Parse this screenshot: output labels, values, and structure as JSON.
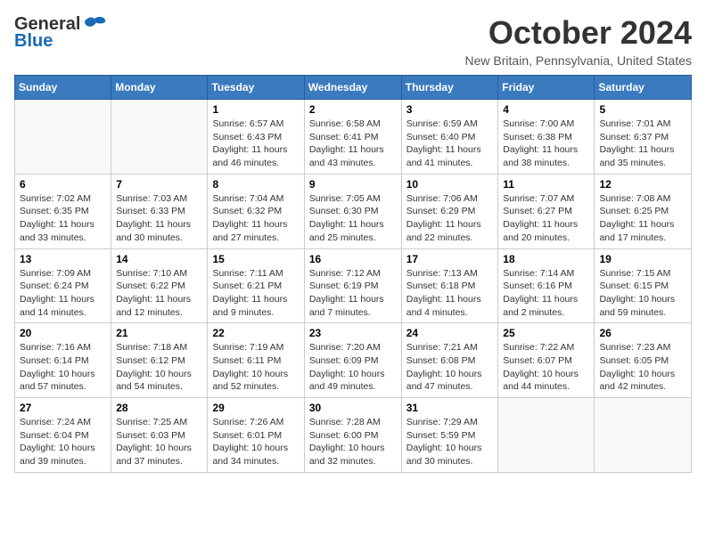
{
  "header": {
    "logo_general": "General",
    "logo_blue": "Blue",
    "month_title": "October 2024",
    "location": "New Britain, Pennsylvania, United States"
  },
  "weekdays": [
    "Sunday",
    "Monday",
    "Tuesday",
    "Wednesday",
    "Thursday",
    "Friday",
    "Saturday"
  ],
  "weeks": [
    [
      {
        "day": "",
        "info": ""
      },
      {
        "day": "",
        "info": ""
      },
      {
        "day": "1",
        "info": "Sunrise: 6:57 AM\nSunset: 6:43 PM\nDaylight: 11 hours and 46 minutes."
      },
      {
        "day": "2",
        "info": "Sunrise: 6:58 AM\nSunset: 6:41 PM\nDaylight: 11 hours and 43 minutes."
      },
      {
        "day": "3",
        "info": "Sunrise: 6:59 AM\nSunset: 6:40 PM\nDaylight: 11 hours and 41 minutes."
      },
      {
        "day": "4",
        "info": "Sunrise: 7:00 AM\nSunset: 6:38 PM\nDaylight: 11 hours and 38 minutes."
      },
      {
        "day": "5",
        "info": "Sunrise: 7:01 AM\nSunset: 6:37 PM\nDaylight: 11 hours and 35 minutes."
      }
    ],
    [
      {
        "day": "6",
        "info": "Sunrise: 7:02 AM\nSunset: 6:35 PM\nDaylight: 11 hours and 33 minutes."
      },
      {
        "day": "7",
        "info": "Sunrise: 7:03 AM\nSunset: 6:33 PM\nDaylight: 11 hours and 30 minutes."
      },
      {
        "day": "8",
        "info": "Sunrise: 7:04 AM\nSunset: 6:32 PM\nDaylight: 11 hours and 27 minutes."
      },
      {
        "day": "9",
        "info": "Sunrise: 7:05 AM\nSunset: 6:30 PM\nDaylight: 11 hours and 25 minutes."
      },
      {
        "day": "10",
        "info": "Sunrise: 7:06 AM\nSunset: 6:29 PM\nDaylight: 11 hours and 22 minutes."
      },
      {
        "day": "11",
        "info": "Sunrise: 7:07 AM\nSunset: 6:27 PM\nDaylight: 11 hours and 20 minutes."
      },
      {
        "day": "12",
        "info": "Sunrise: 7:08 AM\nSunset: 6:25 PM\nDaylight: 11 hours and 17 minutes."
      }
    ],
    [
      {
        "day": "13",
        "info": "Sunrise: 7:09 AM\nSunset: 6:24 PM\nDaylight: 11 hours and 14 minutes."
      },
      {
        "day": "14",
        "info": "Sunrise: 7:10 AM\nSunset: 6:22 PM\nDaylight: 11 hours and 12 minutes."
      },
      {
        "day": "15",
        "info": "Sunrise: 7:11 AM\nSunset: 6:21 PM\nDaylight: 11 hours and 9 minutes."
      },
      {
        "day": "16",
        "info": "Sunrise: 7:12 AM\nSunset: 6:19 PM\nDaylight: 11 hours and 7 minutes."
      },
      {
        "day": "17",
        "info": "Sunrise: 7:13 AM\nSunset: 6:18 PM\nDaylight: 11 hours and 4 minutes."
      },
      {
        "day": "18",
        "info": "Sunrise: 7:14 AM\nSunset: 6:16 PM\nDaylight: 11 hours and 2 minutes."
      },
      {
        "day": "19",
        "info": "Sunrise: 7:15 AM\nSunset: 6:15 PM\nDaylight: 10 hours and 59 minutes."
      }
    ],
    [
      {
        "day": "20",
        "info": "Sunrise: 7:16 AM\nSunset: 6:14 PM\nDaylight: 10 hours and 57 minutes."
      },
      {
        "day": "21",
        "info": "Sunrise: 7:18 AM\nSunset: 6:12 PM\nDaylight: 10 hours and 54 minutes."
      },
      {
        "day": "22",
        "info": "Sunrise: 7:19 AM\nSunset: 6:11 PM\nDaylight: 10 hours and 52 minutes."
      },
      {
        "day": "23",
        "info": "Sunrise: 7:20 AM\nSunset: 6:09 PM\nDaylight: 10 hours and 49 minutes."
      },
      {
        "day": "24",
        "info": "Sunrise: 7:21 AM\nSunset: 6:08 PM\nDaylight: 10 hours and 47 minutes."
      },
      {
        "day": "25",
        "info": "Sunrise: 7:22 AM\nSunset: 6:07 PM\nDaylight: 10 hours and 44 minutes."
      },
      {
        "day": "26",
        "info": "Sunrise: 7:23 AM\nSunset: 6:05 PM\nDaylight: 10 hours and 42 minutes."
      }
    ],
    [
      {
        "day": "27",
        "info": "Sunrise: 7:24 AM\nSunset: 6:04 PM\nDaylight: 10 hours and 39 minutes."
      },
      {
        "day": "28",
        "info": "Sunrise: 7:25 AM\nSunset: 6:03 PM\nDaylight: 10 hours and 37 minutes."
      },
      {
        "day": "29",
        "info": "Sunrise: 7:26 AM\nSunset: 6:01 PM\nDaylight: 10 hours and 34 minutes."
      },
      {
        "day": "30",
        "info": "Sunrise: 7:28 AM\nSunset: 6:00 PM\nDaylight: 10 hours and 32 minutes."
      },
      {
        "day": "31",
        "info": "Sunrise: 7:29 AM\nSunset: 5:59 PM\nDaylight: 10 hours and 30 minutes."
      },
      {
        "day": "",
        "info": ""
      },
      {
        "day": "",
        "info": ""
      }
    ]
  ]
}
